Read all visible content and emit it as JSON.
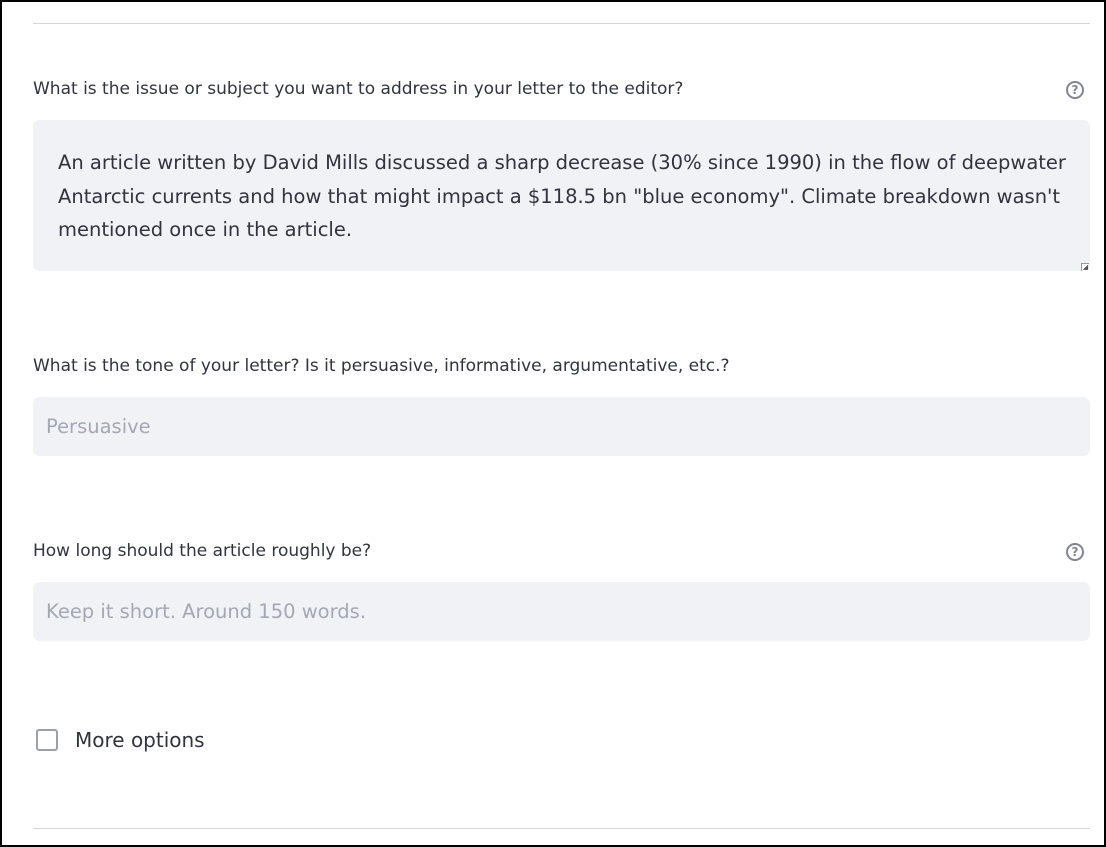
{
  "form": {
    "issue": {
      "label": "What is the issue or subject you want to address in your letter to the editor?",
      "help_icon": "question-circle-icon",
      "value": "An article written by David Mills discussed a sharp decrease (30% since 1990) in the flow of deepwater Antarctic currents and how that might impact a $118.5 bn \"blue economy\". Climate breakdown wasn't mentioned once in the article."
    },
    "tone": {
      "label": "What is the tone of your letter? Is it persuasive, informative, argumentative, etc.?",
      "placeholder": "Persuasive",
      "value": ""
    },
    "length": {
      "label": "How long should the article roughly be?",
      "help_icon": "question-circle-icon",
      "placeholder": "Keep it short. Around 150 words.",
      "value": ""
    },
    "more_options": {
      "label": "More options",
      "checked": false
    }
  }
}
